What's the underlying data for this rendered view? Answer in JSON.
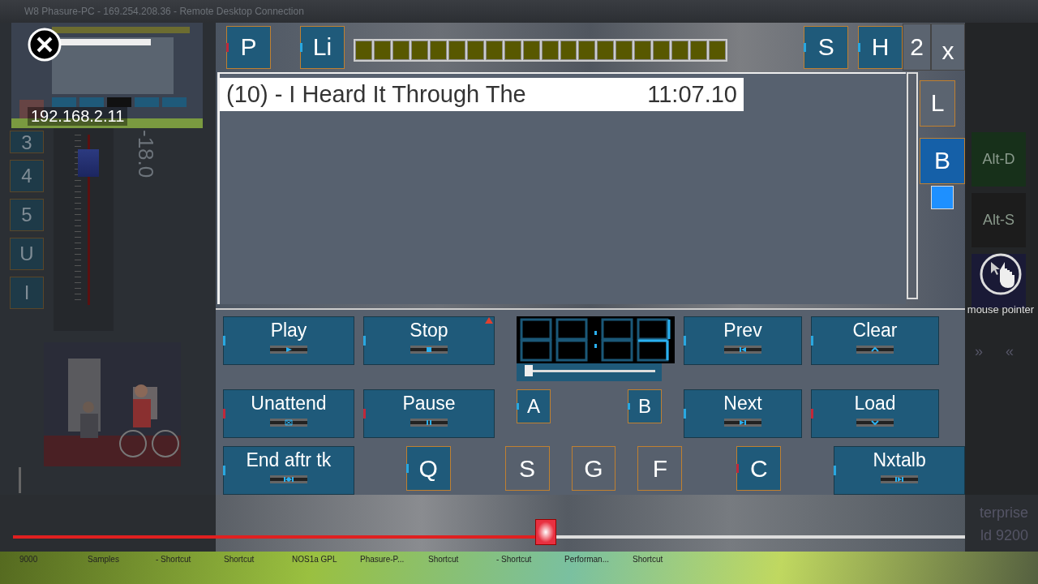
{
  "window": {
    "title": "W8 Phasure-PC - 169.254.208.36 - Remote Desktop Connection"
  },
  "preview": {
    "address": "192.168.2.11"
  },
  "side_buttons": [
    {
      "label": "3"
    },
    {
      "label": "4"
    },
    {
      "label": "5"
    },
    {
      "label": "U"
    },
    {
      "label": "I"
    }
  ],
  "fader": {
    "level": 0.9,
    "reading": "-18.0"
  },
  "top_bar": {
    "left_buttons": [
      {
        "label": "P",
        "color": "#c0283a"
      },
      {
        "label": "Li",
        "color": "#29a8e0"
      }
    ],
    "meter": {
      "level": 0
    },
    "right_buttons": [
      {
        "label": "S",
        "color": "#29a8e0"
      },
      {
        "label": "H",
        "color": "#29a8e0"
      }
    ],
    "page": "2",
    "close": "x"
  },
  "playlist": {
    "items": [
      {
        "title": "(10) - I Heard It Through The",
        "time": "11:07.10",
        "selected": true
      }
    ]
  },
  "side_tabs": [
    {
      "label": "L",
      "selected": false
    },
    {
      "label": "B",
      "selected": true
    }
  ],
  "control_rows": [
    [
      {
        "kind": "wide",
        "label": "Play",
        "color": "#29a8e0"
      },
      {
        "kind": "wide",
        "label": "Stop",
        "color": "#29a8e0",
        "alert": true
      },
      {
        "kind": "display"
      },
      {
        "kind": "wide",
        "label": "Prev",
        "color": "#29a8e0"
      },
      {
        "kind": "wide",
        "label": "Clear",
        "color": "#29a8e0"
      }
    ],
    [
      {
        "kind": "wide",
        "label": "Unattend",
        "color": "#c0283a"
      },
      {
        "kind": "wide",
        "label": "Pause",
        "color": "#c0283a"
      },
      {
        "kind": "square",
        "label": "A",
        "color": "#29a8e0"
      },
      {
        "kind": "square",
        "label": "B",
        "color": "#29a8e0"
      },
      {
        "kind": "wide",
        "label": "Next",
        "color": "#29a8e0"
      },
      {
        "kind": "wide",
        "label": "Load",
        "color": "#c0283a"
      }
    ],
    [
      {
        "kind": "wide",
        "label": "End aftr tk",
        "color": "#29a8e0"
      },
      {
        "kind": "square",
        "label": "Q",
        "color": "#29a8e0"
      },
      {
        "kind": "plain",
        "label": "S"
      },
      {
        "kind": "plain",
        "label": "G"
      },
      {
        "kind": "plain",
        "label": "F"
      },
      {
        "kind": "square",
        "label": "C",
        "color": "#c0283a"
      },
      {
        "kind": "wide",
        "label": "Nxtalb",
        "color": "#29a8e0"
      }
    ]
  ],
  "position_slider": {
    "level": 0.03
  },
  "seek": {
    "level": 0.56
  },
  "shortcuts": [
    {
      "label": "Alt-D",
      "color": "#17301a"
    },
    {
      "label": "Alt-S",
      "color": "#1c1c1c"
    },
    {
      "color": "#1a1a36"
    }
  ],
  "nav": [
    "»",
    "«"
  ],
  "mouse_pointer": {
    "label": "mouse pointer"
  },
  "desktop_text": [
    "terprise",
    "ld 9200"
  ],
  "taskbar": {
    "items": [
      "9000",
      "Samples",
      "- Shortcut",
      "Shortcut",
      "NOS1a GPL",
      "Phasure-P...",
      "Shortcut",
      "- Shortcut",
      "Performan...",
      "Shortcut"
    ]
  }
}
